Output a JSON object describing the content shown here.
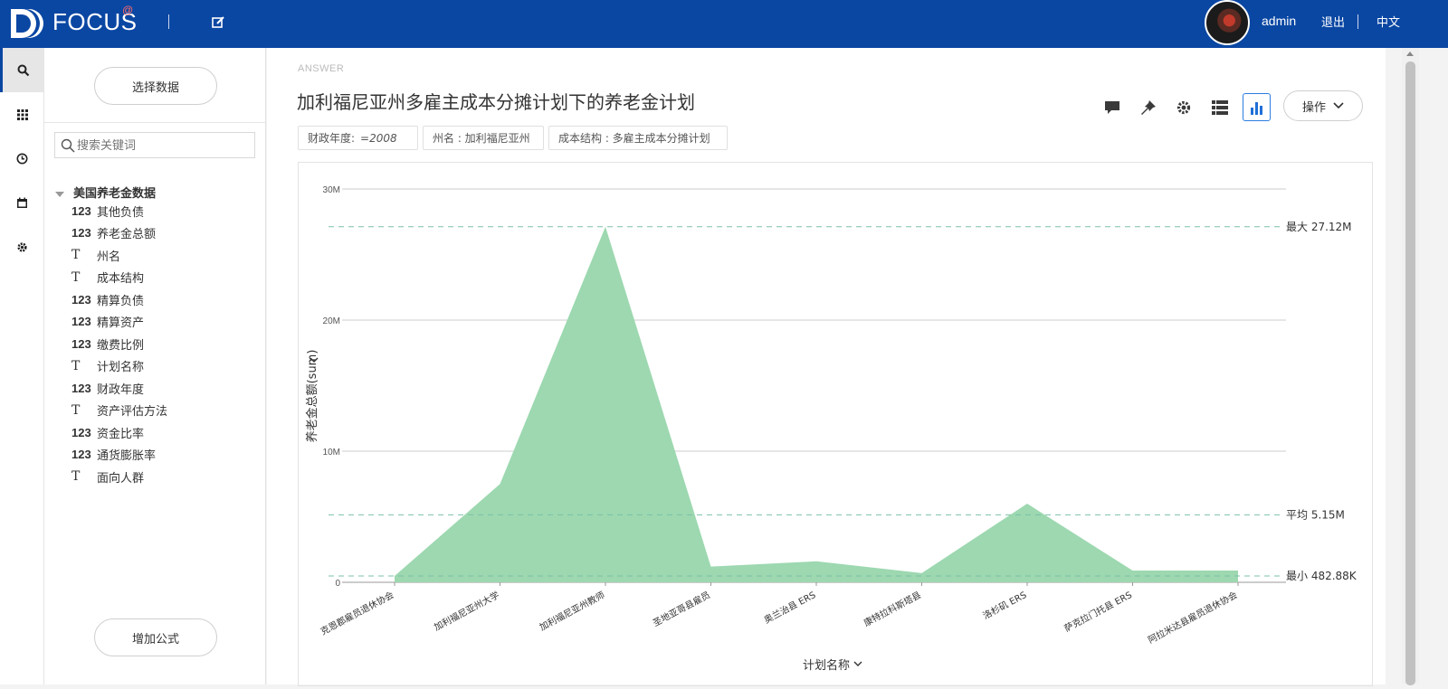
{
  "header": {
    "logo_text": "FOCUS",
    "logo_at": "@",
    "user": "admin",
    "logout": "退出",
    "language": "中文"
  },
  "nav_icons": [
    "search-icon",
    "grid-icon",
    "history-icon",
    "calendar-icon",
    "settings-icon"
  ],
  "sidebar": {
    "select_data_button": "选择数据",
    "search_placeholder": "搜索关键词",
    "tree_root": "美国养老金数据",
    "fields": [
      {
        "type": "123",
        "label": "其他负债"
      },
      {
        "type": "123",
        "label": "养老金总额"
      },
      {
        "type": "T",
        "label": "州名"
      },
      {
        "type": "T",
        "label": "成本结构"
      },
      {
        "type": "123",
        "label": "精算负债"
      },
      {
        "type": "123",
        "label": "精算资产"
      },
      {
        "type": "123",
        "label": "缴费比例"
      },
      {
        "type": "T",
        "label": "计划名称"
      },
      {
        "type": "123",
        "label": "财政年度"
      },
      {
        "type": "T",
        "label": "资产评估方法"
      },
      {
        "type": "123",
        "label": "资金比率"
      },
      {
        "type": "123",
        "label": "通货膨胀率"
      },
      {
        "type": "T",
        "label": "面向人群"
      }
    ],
    "add_formula_button": "增加公式"
  },
  "main": {
    "answer_label": "ANSWER",
    "title": "加利福尼亚州多雇主成本分摊计划下的养老金计划",
    "operate_button": "操作",
    "toolbar_icons": [
      "comment-icon",
      "pin-icon",
      "gear-icon",
      "table-view-icon",
      "chart-view-icon"
    ],
    "filters": [
      {
        "label": "财政年度:",
        "value": "=2008"
      },
      {
        "label": "州名 : 加利福尼亚州",
        "value": ""
      },
      {
        "label": "成本结构 : 多雇主成本分摊计划",
        "value": ""
      }
    ]
  },
  "chart_data": {
    "type": "area",
    "xlabel": "计划名称",
    "ylabel": "养老金总额(sum)",
    "ylim": [
      0,
      30000000
    ],
    "yticks": [
      "0",
      "10M",
      "20M",
      "30M"
    ],
    "ytick_values": [
      0,
      10000000,
      20000000,
      30000000
    ],
    "categories": [
      "克恩郡雇员退休协会",
      "加利福尼亚州大学",
      "加利福尼亚州教师",
      "圣地亚哥县雇员",
      "奥兰治县 ERS",
      "康特拉科斯塔县",
      "洛杉矶 ERS",
      "萨克拉门托县 ERS",
      "阿拉米达县雇员退休协会"
    ],
    "values": [
      482880,
      7500000,
      27120000,
      1200000,
      1600000,
      700000,
      6000000,
      900000,
      900000
    ],
    "color": "#9dd8b0",
    "reference_lines": [
      {
        "label": "最大 27.12M",
        "value": 27120000
      },
      {
        "label": "平均 5.15M",
        "value": 5150000
      },
      {
        "label": "最小 482.88K",
        "value": 482880
      }
    ],
    "grid": true
  }
}
